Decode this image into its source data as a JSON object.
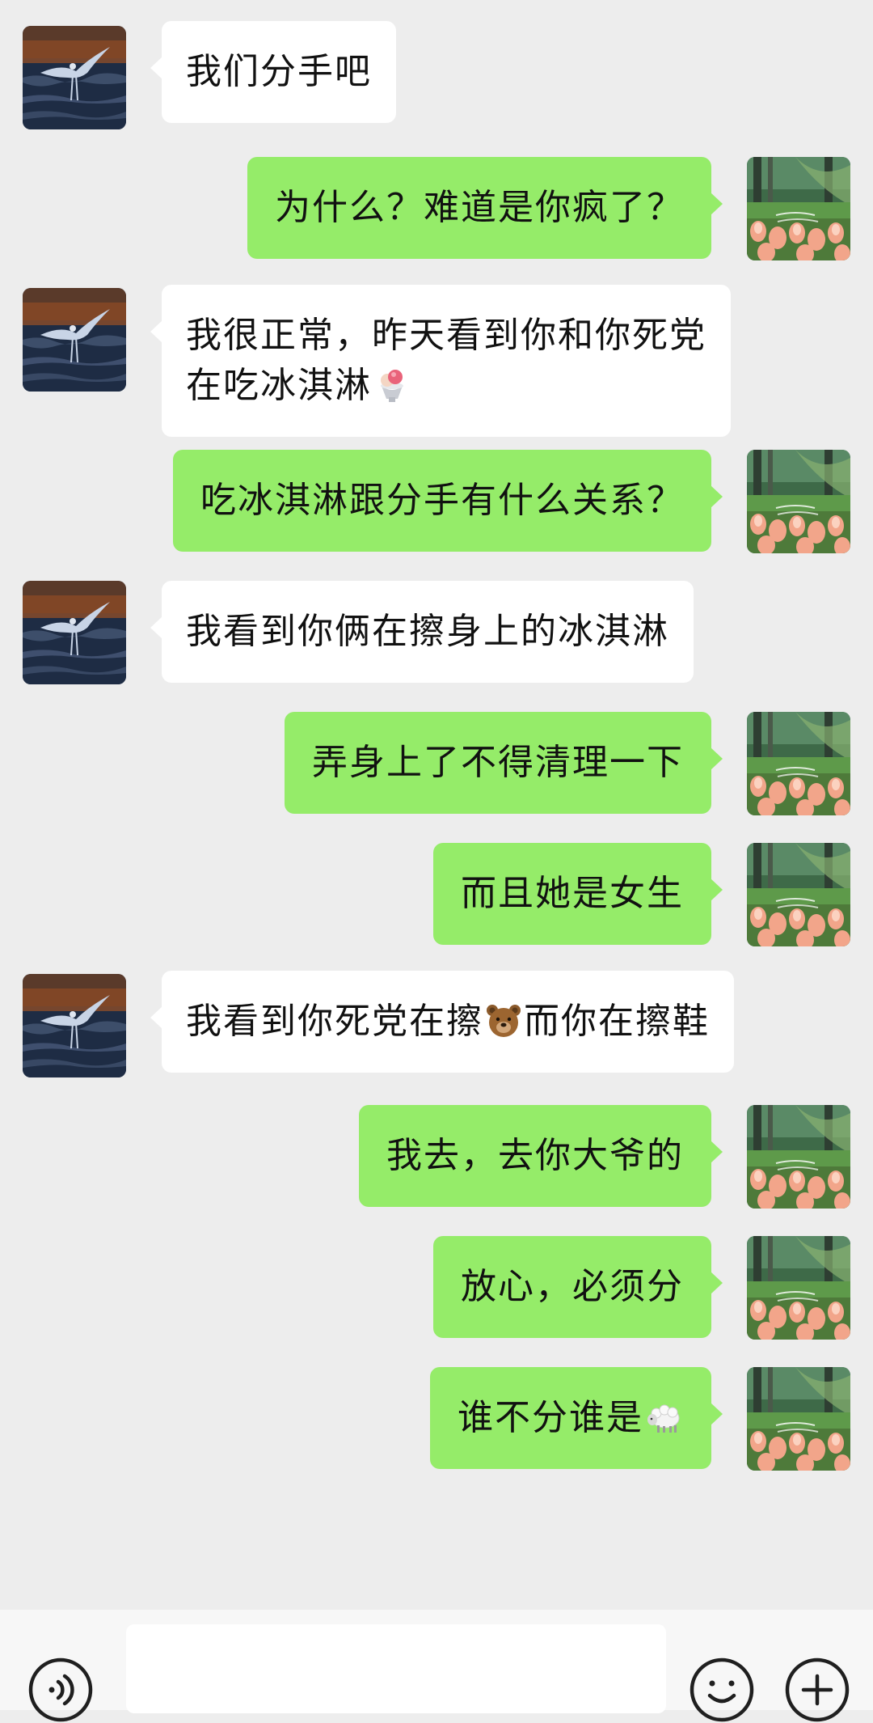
{
  "messages": [
    {
      "side": "in",
      "text": "我们分手吧"
    },
    {
      "side": "out",
      "text": "为什么？难道是你疯了？"
    },
    {
      "side": "in",
      "line1": "我很正常，昨天看到你和你死党",
      "line2": "在吃冰淇淋"
    },
    {
      "side": "out",
      "text": "吃冰淇淋跟分手有什么关系？"
    },
    {
      "side": "in",
      "text": "我看到你俩在擦身上的冰淇淋"
    },
    {
      "side": "out",
      "text": "弄身上了不得清理一下"
    },
    {
      "side": "out",
      "text": "而且她是女生"
    },
    {
      "side": "in",
      "text_a": "我看到你死党在擦",
      "text_b": "而你在擦鞋"
    },
    {
      "side": "out",
      "text": "我去，去你大爷的"
    },
    {
      "side": "out",
      "text": "放心，必须分"
    },
    {
      "side": "out",
      "text": "谁不分谁是"
    }
  ],
  "emojis": {
    "m3": "ice-cream-emoji",
    "m8": "bear-face-emoji",
    "m11": "sheep-emoji"
  },
  "colors": {
    "background": "#ededed",
    "incoming_bubble": "#ffffff",
    "outgoing_bubble": "#95ec69",
    "bottom_bar": "#f7f7f7"
  },
  "bottom_bar": {
    "voice_icon": "voice-icon",
    "emoji_icon": "smiley-icon",
    "plus_icon": "plus-icon"
  }
}
